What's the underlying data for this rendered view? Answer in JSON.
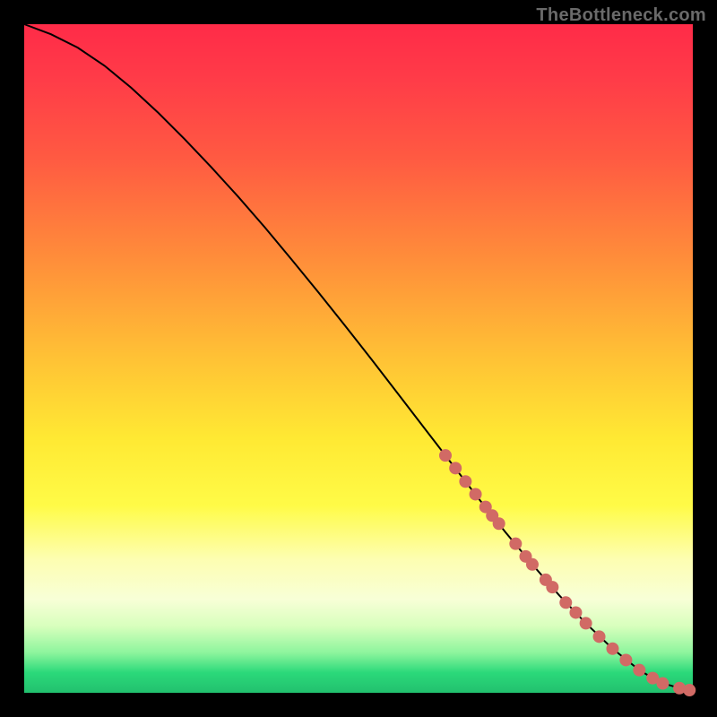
{
  "watermark": "TheBottleneck.com",
  "chart_data": {
    "type": "line",
    "title": "",
    "xlabel": "",
    "ylabel": "",
    "xlim": [
      0,
      100
    ],
    "ylim": [
      0,
      100
    ],
    "grid": false,
    "series": [
      {
        "name": "curve",
        "x": [
          0,
          4,
          8,
          12,
          16,
          20,
          24,
          28,
          32,
          36,
          40,
          44,
          48,
          52,
          56,
          60,
          64,
          68,
          72,
          76,
          80,
          84,
          88,
          92,
          94,
          96,
          98,
          100
        ],
        "y": [
          100,
          98.5,
          96.5,
          93.8,
          90.5,
          86.8,
          82.8,
          78.6,
          74.2,
          69.6,
          64.8,
          59.9,
          54.9,
          49.8,
          44.6,
          39.4,
          34.2,
          29.0,
          24.0,
          19.2,
          14.6,
          10.4,
          6.6,
          3.4,
          2.2,
          1.3,
          0.7,
          0.4
        ]
      }
    ],
    "marker_points": [
      {
        "x": 63.0,
        "y": 35.5
      },
      {
        "x": 64.5,
        "y": 33.6
      },
      {
        "x": 66.0,
        "y": 31.6
      },
      {
        "x": 67.5,
        "y": 29.7
      },
      {
        "x": 69.0,
        "y": 27.8
      },
      {
        "x": 70.0,
        "y": 26.5
      },
      {
        "x": 71.0,
        "y": 25.3
      },
      {
        "x": 73.5,
        "y": 22.3
      },
      {
        "x": 75.0,
        "y": 20.4
      },
      {
        "x": 76.0,
        "y": 19.2
      },
      {
        "x": 78.0,
        "y": 16.9
      },
      {
        "x": 79.0,
        "y": 15.8
      },
      {
        "x": 81.0,
        "y": 13.5
      },
      {
        "x": 82.5,
        "y": 12.0
      },
      {
        "x": 84.0,
        "y": 10.4
      },
      {
        "x": 86.0,
        "y": 8.4
      },
      {
        "x": 88.0,
        "y": 6.6
      },
      {
        "x": 90.0,
        "y": 4.9
      },
      {
        "x": 92.0,
        "y": 3.4
      },
      {
        "x": 94.0,
        "y": 2.2
      },
      {
        "x": 95.5,
        "y": 1.4
      },
      {
        "x": 98.0,
        "y": 0.7
      },
      {
        "x": 99.5,
        "y": 0.4
      }
    ],
    "marker_radius": 7,
    "colors": {
      "curve": "#000000",
      "markers": "#d16a65",
      "gradient_top": "#ff2b48",
      "gradient_mid": "#ffe933",
      "gradient_bottom": "#22c06e",
      "background": "#000000"
    }
  }
}
